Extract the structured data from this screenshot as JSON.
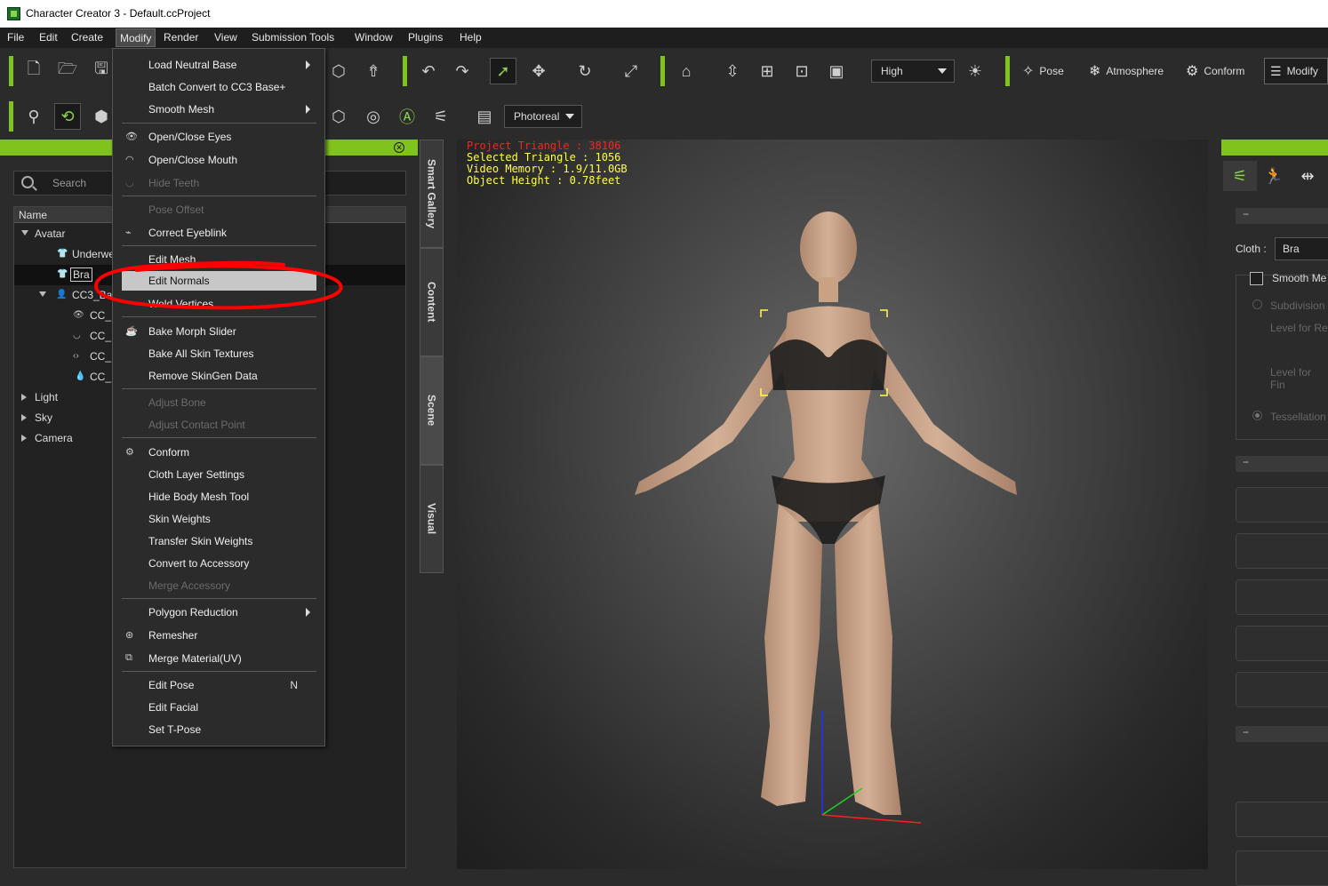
{
  "window": {
    "title": "Character Creator 3 - Default.ccProject"
  },
  "menubar": {
    "items": [
      "File",
      "Edit",
      "Create",
      "Modify",
      "Render",
      "View",
      "Submission Tools",
      "Window",
      "Plugins",
      "Help"
    ],
    "active": "Modify"
  },
  "toolbar": {
    "quality_select": "High",
    "render_mode_select": "Photoreal",
    "pose_label": "Pose",
    "atmosphere_label": "Atmosphere",
    "conform_label": "Conform",
    "modify_label": "Modify"
  },
  "left_panel": {
    "search_placeholder": "Search",
    "column_header": "Name",
    "tree": [
      {
        "label": "Avatar"
      },
      {
        "label": "Underwe"
      },
      {
        "label": "Bra"
      },
      {
        "label": "CC3_Ba"
      },
      {
        "label": "CC_"
      },
      {
        "label": "CC_"
      },
      {
        "label": "CC_"
      },
      {
        "label": "CC_"
      },
      {
        "label": "Light"
      },
      {
        "label": "Sky"
      },
      {
        "label": "Camera"
      }
    ]
  },
  "side_tabs": [
    "Smart Gallery",
    "Content",
    "Scene",
    "Visual"
  ],
  "viewport": {
    "stats": {
      "project_triangle": "Project Triangle : 38106",
      "selected_triangle": "Selected Triangle : 1056",
      "video_memory": "Video Memory : 1.9/11.0GB",
      "object_height": "Object Height : 0.78feet"
    }
  },
  "right_panel": {
    "cloth_label": "Cloth :",
    "cloth_value": "Bra",
    "smooth_mesh_label": "Smooth Me",
    "subdivision_label": "Subdivision",
    "level_render_label": "Level for Re",
    "level_final_label": "Level for Fin",
    "tessellation_label": "Tessellation",
    "collapse_symbol": "−"
  },
  "modify_menu": {
    "items": [
      {
        "label": "Load Neutral Base",
        "submenu": true
      },
      {
        "label": "Batch Convert to CC3 Base+"
      },
      {
        "label": "Smooth Mesh",
        "submenu": true
      },
      {
        "label": "Open/Close Eyes",
        "icon": "eye-icon"
      },
      {
        "label": "Open/Close Mouth",
        "icon": "mouth-icon"
      },
      {
        "label": "Hide Teeth",
        "icon": "teeth-icon",
        "disabled": true
      },
      {
        "label": "Pose Offset",
        "disabled": true
      },
      {
        "label": "Correct Eyeblink",
        "icon": "eyeblink-icon"
      },
      {
        "label": "Edit Mesh"
      },
      {
        "label": "Edit Normals",
        "highlighted": true
      },
      {
        "label": "Weld Vertices"
      },
      {
        "label": "Bake Morph Slider",
        "icon": "bake-icon"
      },
      {
        "label": "Bake All Skin Textures"
      },
      {
        "label": "Remove SkinGen Data"
      },
      {
        "label": "Adjust Bone",
        "disabled": true
      },
      {
        "label": "Adjust Contact Point",
        "disabled": true
      },
      {
        "label": "Conform",
        "icon": "conform-icon"
      },
      {
        "label": "Cloth Layer Settings"
      },
      {
        "label": "Hide Body Mesh Tool"
      },
      {
        "label": "Skin Weights"
      },
      {
        "label": "Transfer Skin Weights"
      },
      {
        "label": "Convert to Accessory"
      },
      {
        "label": "Merge Accessory",
        "disabled": true
      },
      {
        "label": "Polygon Reduction",
        "submenu": true
      },
      {
        "label": "Remesher",
        "icon": "remesher-icon"
      },
      {
        "label": "Merge Material(UV)",
        "icon": "merge-material-icon"
      },
      {
        "label": "Edit Pose",
        "shortcut": "N"
      },
      {
        "label": "Edit Facial"
      },
      {
        "label": "Set T-Pose"
      }
    ]
  },
  "colors": {
    "accent_green": "#7fc31c",
    "annotation_red": "#ff0000",
    "menu_highlight": "#c7c7c7"
  }
}
